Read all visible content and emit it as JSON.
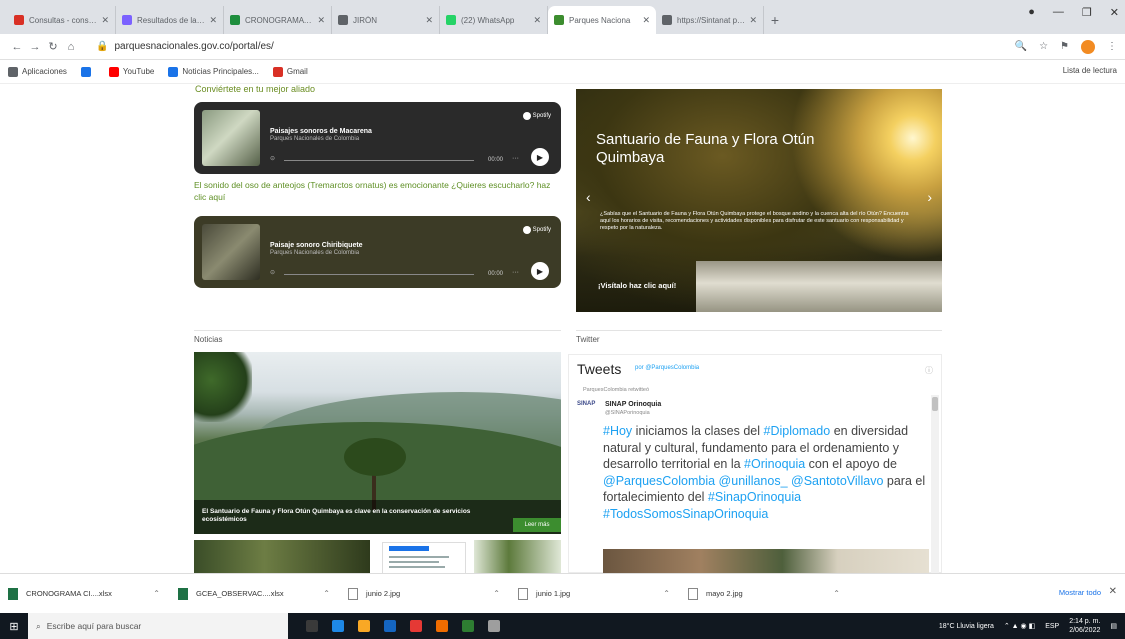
{
  "browser": {
    "tabs": [
      {
        "label": "Consultas - consulta",
        "color": "#d93025"
      },
      {
        "label": "Resultados de la búsqueda",
        "color": "#7b61ff"
      },
      {
        "label": "CRONOGRAMA CHV",
        "color": "#1e8e3e"
      },
      {
        "label": "JIRÓN",
        "color": "#5f6368"
      },
      {
        "label": "(22) WhatsApp",
        "color": "#25d366"
      },
      {
        "label": "Parques Naciona",
        "color": "#3c8d2f"
      },
      {
        "label": "https://Sintanat para",
        "color": "#5f6368"
      }
    ],
    "new_tab": "+",
    "url": "parquesnacionales.gov.co/portal/es/",
    "bookmarks": [
      {
        "label": "Aplicaciones",
        "color": "#5f6368"
      },
      {
        "label": "",
        "color": "#1a73e8"
      },
      {
        "label": "YouTube",
        "color": "#ff0000"
      },
      {
        "label": "Noticias Principales...",
        "color": "#1a73e8"
      },
      {
        "label": "Gmail",
        "color": "#d93025"
      }
    ],
    "reading_list": "Lista de lectura"
  },
  "page": {
    "cutoff_text": "Conviértete en tu mejor aliado",
    "players": [
      {
        "title": "Paisajes sonoros de Macarena",
        "subtitle": "Parques Nacionales de Colombia",
        "duration": "00:00",
        "brand": "Spotify",
        "bg": "#2a2a2a"
      },
      {
        "title": "Paisaje sonoro Chiribiquete",
        "subtitle": "Parques Nacionales de Colombia",
        "duration": "00:00",
        "brand": "Spotify",
        "bg": "#3c3b26"
      }
    ],
    "green_link": "El sonido del oso de anteojos (Tremarctos ornatus) es emocionante ¿Quieres escucharlo? haz clic aquí",
    "hero": {
      "title": "Santuario de Fauna y Flora Otún Quimbaya",
      "description": "¿Sabías que el Santuario de Fauna y Flora Otún Quimbaya protege el bosque andino y la cuenca alta del río Otún? Encuentra aquí los horarios de visita, recomendaciones y actividades disponibles para disfrutar de este santuario con responsabilidad y respeto por la naturaleza.",
      "cta": "¡Visítalo haz clic aquí!"
    },
    "news": {
      "section": "Noticias",
      "caption": "El Santuario de Fauna y Flora Otún Quimbaya es clave en la conservación de servicios ecosistémicos",
      "button": "Leer más"
    },
    "twitter": {
      "section": "Twitter",
      "heading": "Tweets",
      "by": "por @ParquesColombia",
      "retweet": "ParquesColombia retwitteó",
      "author_avatar": "SINAP",
      "author_name": "SINAP Orinoquia",
      "author_handle": "@SINAPorinoquia",
      "body_parts": [
        {
          "t": "#Hoy",
          "h": true
        },
        {
          "t": " iniciamos la clases del ",
          "h": false
        },
        {
          "t": "#Diplomado",
          "h": true
        },
        {
          "t": " en diversidad natural y cultural, fundamento para el ordenamiento y desarrollo territorial en la ",
          "h": false
        },
        {
          "t": "#Orinoquia",
          "h": true
        },
        {
          "t": " con el apoyo de ",
          "h": false
        },
        {
          "t": "@ParquesColombia",
          "h": true
        },
        {
          "t": " ",
          "h": false
        },
        {
          "t": "@unillanos_",
          "h": true
        },
        {
          "t": " ",
          "h": false
        },
        {
          "t": "@SantotoVillavo",
          "h": true
        },
        {
          "t": " para el fortalecimiento del ",
          "h": false
        },
        {
          "t": "#SinapOrinoquia",
          "h": true
        },
        {
          "t": " ",
          "h": false
        },
        {
          "t": "#TodosSomosSinapOrinoquia",
          "h": true
        }
      ]
    }
  },
  "downloads": {
    "items": [
      {
        "name": "CRONOGRAMA CI....xlsx",
        "type": "xl"
      },
      {
        "name": "GCEA_OBSERVAC....xlsx",
        "type": "xl"
      },
      {
        "name": "junio 2.jpg",
        "type": "img"
      },
      {
        "name": "junio 1.jpg",
        "type": "img"
      },
      {
        "name": "mayo 2.jpg",
        "type": "img"
      }
    ],
    "show_all": "Mostrar todo"
  },
  "taskbar": {
    "search_placeholder": "Escribe aquí para buscar",
    "apps": [
      "#3a3a3a",
      "#1e88e5",
      "#f9a825",
      "#1565c0",
      "#e53935",
      "#ef6c00",
      "#2e7d32",
      "#9e9e9e"
    ],
    "weather": "18°C Lluvia ligera",
    "language": "ESP",
    "time": "2:14 p. m.",
    "date": "2/06/2022"
  }
}
